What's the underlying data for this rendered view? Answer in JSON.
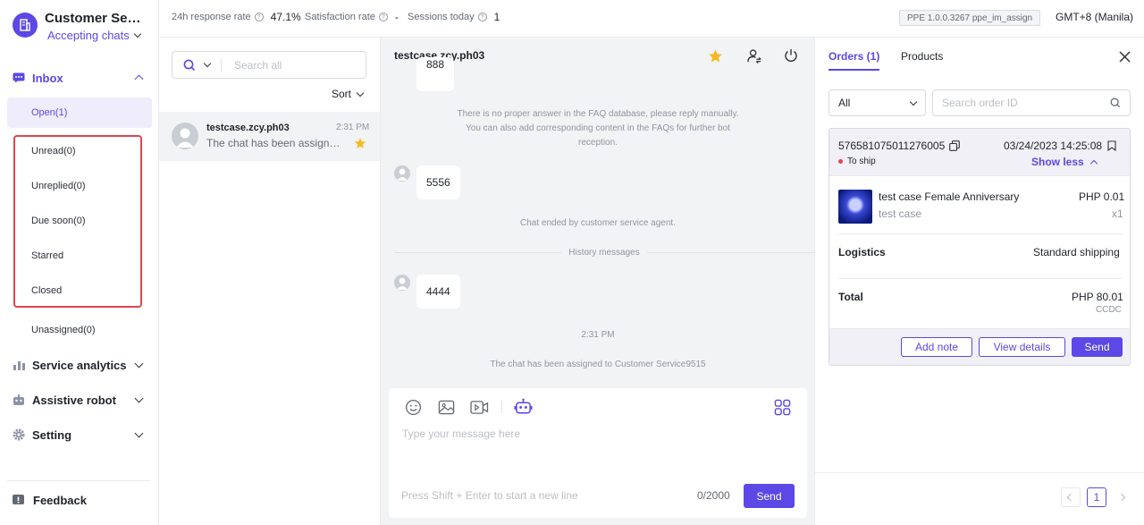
{
  "app": {
    "title": "Customer Servi...",
    "status": "Accepting chats"
  },
  "sidebar": {
    "inbox_label": "Inbox",
    "inbox_items": [
      {
        "label": "Open(1)"
      },
      {
        "label": "Unread(0)"
      },
      {
        "label": "Unreplied(0)"
      },
      {
        "label": "Due soon(0)"
      },
      {
        "label": "Starred"
      },
      {
        "label": "Closed"
      },
      {
        "label": "Unassigned(0)"
      }
    ],
    "sections": [
      {
        "label": "Service analytics"
      },
      {
        "label": "Assistive robot"
      },
      {
        "label": "Setting"
      }
    ],
    "feedback": "Feedback"
  },
  "topbar": {
    "metrics": [
      {
        "label": "24h response rate",
        "value": "47.1%"
      },
      {
        "label": "Satisfaction rate",
        "value": "-"
      },
      {
        "label": "Sessions today",
        "value": "1"
      }
    ],
    "env": "PPE 1.0.0.3267 ppe_im_assign",
    "timezone": "GMT+8 (Manila)"
  },
  "chatlist": {
    "search_placeholder": "Search all",
    "sort_label": "Sort",
    "items": [
      {
        "name": "testcase.zcy.ph03",
        "time": "2:31 PM",
        "preview": "The chat has been assigned to Customer Service9515",
        "starred": true
      }
    ]
  },
  "conversation": {
    "title": "testcase.zcy.ph03",
    "messages": {
      "top_bubble": "888",
      "faq_notice": "There is no proper answer in the FAQ database, please reply manually. You can also add corresponding content in the FAQs for further bot reception.",
      "bubble_1": "5556",
      "chat_ended": "Chat ended by customer service agent.",
      "history": "History messages",
      "bubble_2": "4444",
      "timestamp": "2:31 PM",
      "assigned": "The chat has been assigned to Customer Service9515"
    },
    "composer": {
      "placeholder": "Type your message here",
      "hint": "Press Shift + Enter to start a new line",
      "counter": "0/2000",
      "send": "Send"
    }
  },
  "orders": {
    "tabs": [
      {
        "label": "Orders (1)",
        "active": true
      },
      {
        "label": "Products",
        "active": false
      }
    ],
    "filter": "All",
    "search_placeholder": "Search order ID",
    "order": {
      "id": "576581075011276005",
      "date": "03/24/2023 14:25:08",
      "status": "To ship",
      "toggle": "Show less",
      "product_name": "test case Female Anniversary",
      "product_sub": "test case",
      "price": "PHP 0.01",
      "qty": "x1",
      "logistics_label": "Logistics",
      "logistics_value": "Standard shipping",
      "total_label": "Total",
      "total_value": "PHP 80.01",
      "currency_code": "CCDC"
    },
    "actions": {
      "add_note": "Add note",
      "view_details": "View details",
      "send": "Send"
    },
    "pager": {
      "current": "1"
    }
  },
  "colors": {
    "accent": "#5b48e6",
    "highlight_border": "#e2454d",
    "star": "#f5b91f"
  }
}
